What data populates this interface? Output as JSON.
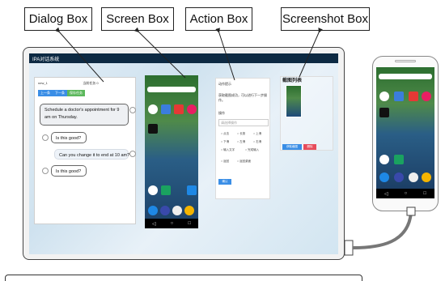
{
  "labels": {
    "dialog": "Dialog Box",
    "screen": "Screen Box",
    "action": "Action Box",
    "screenshot": "Screenshot Box"
  },
  "app": {
    "title": "IPA对话系统"
  },
  "dialog": {
    "header_left": "new_1",
    "header_center": "当前任务 0",
    "tabs": [
      "上一条",
      "下一条",
      "保存任务"
    ],
    "messages": [
      {
        "role": "user",
        "text": "Schedule a doctor's appointment for 9 am on Thursday."
      },
      {
        "role": "system",
        "text": "Is this good?"
      },
      {
        "role": "user",
        "text": "Can you change it to end at 10 am?"
      },
      {
        "role": "system",
        "text": "Is this good?"
      }
    ]
  },
  "action": {
    "title": "动作提示",
    "description": "获取截图成功，可以进行下一步操作。",
    "section": "操作",
    "select_placeholder": "请选择操作",
    "options": [
      "点击",
      "长按",
      "上滑",
      "下滑",
      "左滑",
      "右滑",
      "输入文字",
      "完成输入",
      "返回",
      "返回桌面"
    ],
    "confirm_label": "确认"
  },
  "screenshot": {
    "title": "截图列表",
    "buttons": [
      "获取截图",
      "删除"
    ]
  },
  "colors": {
    "accent": "#3a8ee6",
    "success": "#5cb85c",
    "danger": "#e74c5b",
    "titlebar": "#0d2a43"
  }
}
